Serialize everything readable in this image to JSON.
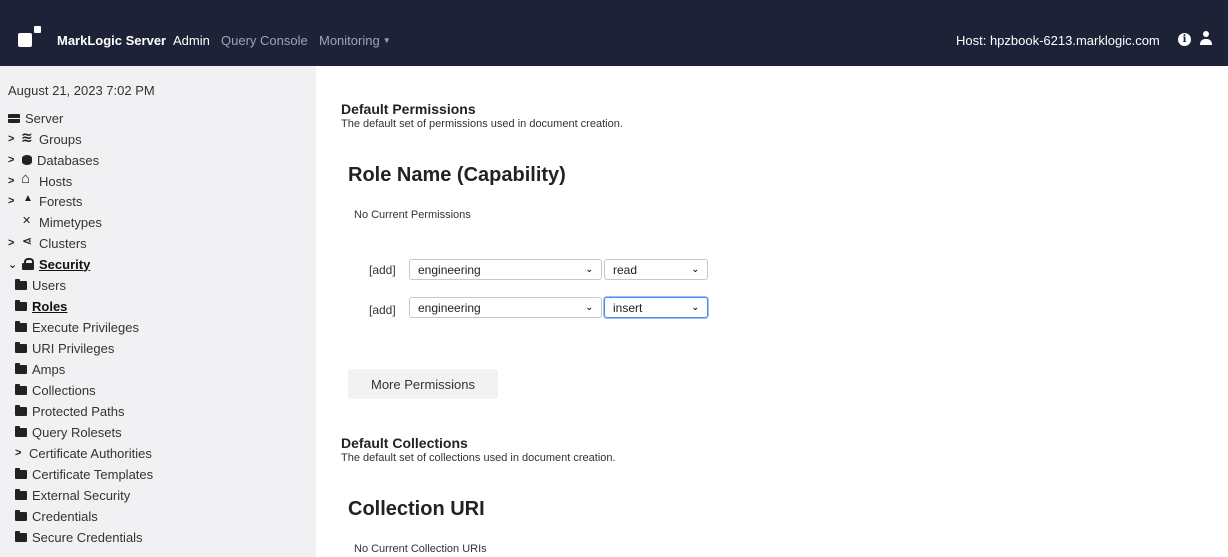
{
  "topbar": {
    "brand": "MarkLogic Server",
    "nav": [
      {
        "label": "Admin",
        "active": true
      },
      {
        "label": "Query Console",
        "active": false
      },
      {
        "label": "Monitoring",
        "active": false,
        "dropdown": true
      }
    ],
    "host": "Host: hpzbook-6213.marklogic.com",
    "background": "#1d2237"
  },
  "sidebar": {
    "date": "August 21, 2023 7:02 PM",
    "items": [
      {
        "label": "Server",
        "icon": "server-icon"
      },
      {
        "label": "Groups",
        "icon": "layers-icon",
        "expandable": true
      },
      {
        "label": "Databases",
        "icon": "database-icon",
        "expandable": true
      },
      {
        "label": "Hosts",
        "icon": "host-icon",
        "expandable": true
      },
      {
        "label": "Forests",
        "icon": "forest-icon",
        "expandable": true
      },
      {
        "label": "Mimetypes",
        "icon": "mimetype-icon"
      },
      {
        "label": "Clusters",
        "icon": "share-icon",
        "expandable": true
      },
      {
        "label": "Security",
        "icon": "lock-icon",
        "expanded": true,
        "active": true
      },
      {
        "label": "Users",
        "icon": "folder-icon"
      },
      {
        "label": "Roles",
        "icon": "folder-icon",
        "active": true
      },
      {
        "label": "Execute Privileges",
        "icon": "folder-icon"
      },
      {
        "label": "URI Privileges",
        "icon": "folder-icon"
      },
      {
        "label": "Amps",
        "icon": "folder-icon"
      },
      {
        "label": "Collections",
        "icon": "folder-icon"
      },
      {
        "label": "Protected Paths",
        "icon": "folder-icon"
      },
      {
        "label": "Query Rolesets",
        "icon": "folder-icon"
      },
      {
        "label": "Certificate Authorities",
        "expandable": true
      },
      {
        "label": "Certificate Templates",
        "icon": "folder-icon"
      },
      {
        "label": "External Security",
        "icon": "folder-icon"
      },
      {
        "label": "Credentials",
        "icon": "folder-icon"
      },
      {
        "label": "Secure Credentials",
        "icon": "folder-icon"
      }
    ]
  },
  "main": {
    "permissions": {
      "title": "Default Permissions",
      "description": "The default set of permissions used in document creation.",
      "heading": "Role Name (Capability)",
      "empty_note": "No Current Permissions",
      "rows": [
        {
          "add": "[add]",
          "role": "engineering",
          "capability": "read"
        },
        {
          "add": "[add]",
          "role": "engineering",
          "capability": "insert"
        }
      ],
      "more_button": "More Permissions"
    },
    "collections": {
      "title": "Default Collections",
      "description": "The default set of collections used in document creation.",
      "heading": "Collection URI",
      "empty_note": "No Current Collection URIs"
    }
  }
}
